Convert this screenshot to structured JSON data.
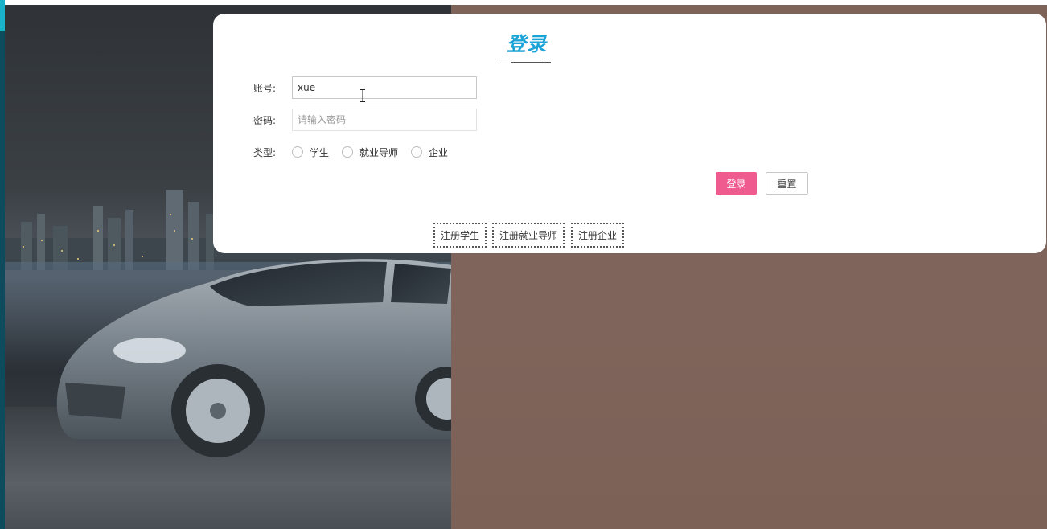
{
  "login": {
    "title": "登录",
    "account_label": "账号:",
    "account_value": "xue",
    "password_label": "密码:",
    "password_placeholder": "请输入密码",
    "type_label": "类型:",
    "type_options": [
      "学生",
      "就业导师",
      "企业"
    ],
    "login_button": "登录",
    "reset_button": "重置"
  },
  "register_links": [
    "注册学生",
    "注册就业导师",
    "注册企业"
  ],
  "colors": {
    "title": "#1aa3d6",
    "login_button": "#ef5b8f",
    "right_background": "#7e645a",
    "edge_bar": "#0c4c5c",
    "edge_accent": "#18b3c9"
  }
}
